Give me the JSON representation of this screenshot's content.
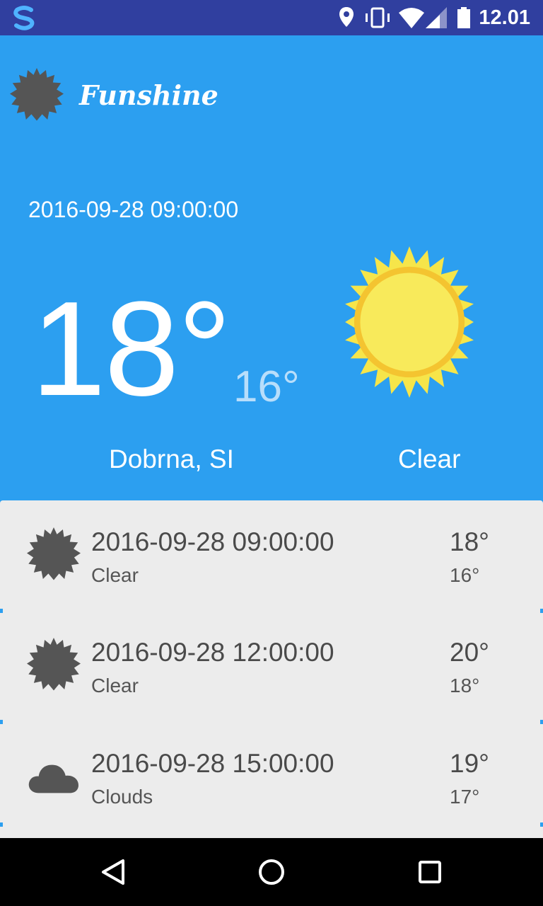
{
  "status_bar": {
    "time": "12.01",
    "icons": [
      "app-s-icon",
      "location-icon",
      "vibrate-icon",
      "wifi-icon",
      "signal-icon",
      "battery-icon"
    ],
    "background_color": "#303f9f"
  },
  "header": {
    "app_name": "Funshine",
    "logo_icon": "sun-icon",
    "date": "2016-09-28 09:00:00",
    "high": "18°",
    "low": "16°",
    "location": "Dobrna, SI",
    "description": "Clear",
    "weather_icon": "sun-icon",
    "background_color": "#2c9ff0"
  },
  "forecast": [
    {
      "icon": "sun-icon",
      "date": "2016-09-28 09:00:00",
      "description": "Clear",
      "high": "18°",
      "low": "16°"
    },
    {
      "icon": "sun-icon",
      "date": "2016-09-28 12:00:00",
      "description": "Clear",
      "high": "20°",
      "low": "18°"
    },
    {
      "icon": "cloud-icon",
      "date": "2016-09-28 15:00:00",
      "description": "Clouds",
      "high": "19°",
      "low": "17°"
    }
  ],
  "nav_bar": {
    "buttons": [
      "back-icon",
      "home-icon",
      "recents-icon"
    ]
  }
}
